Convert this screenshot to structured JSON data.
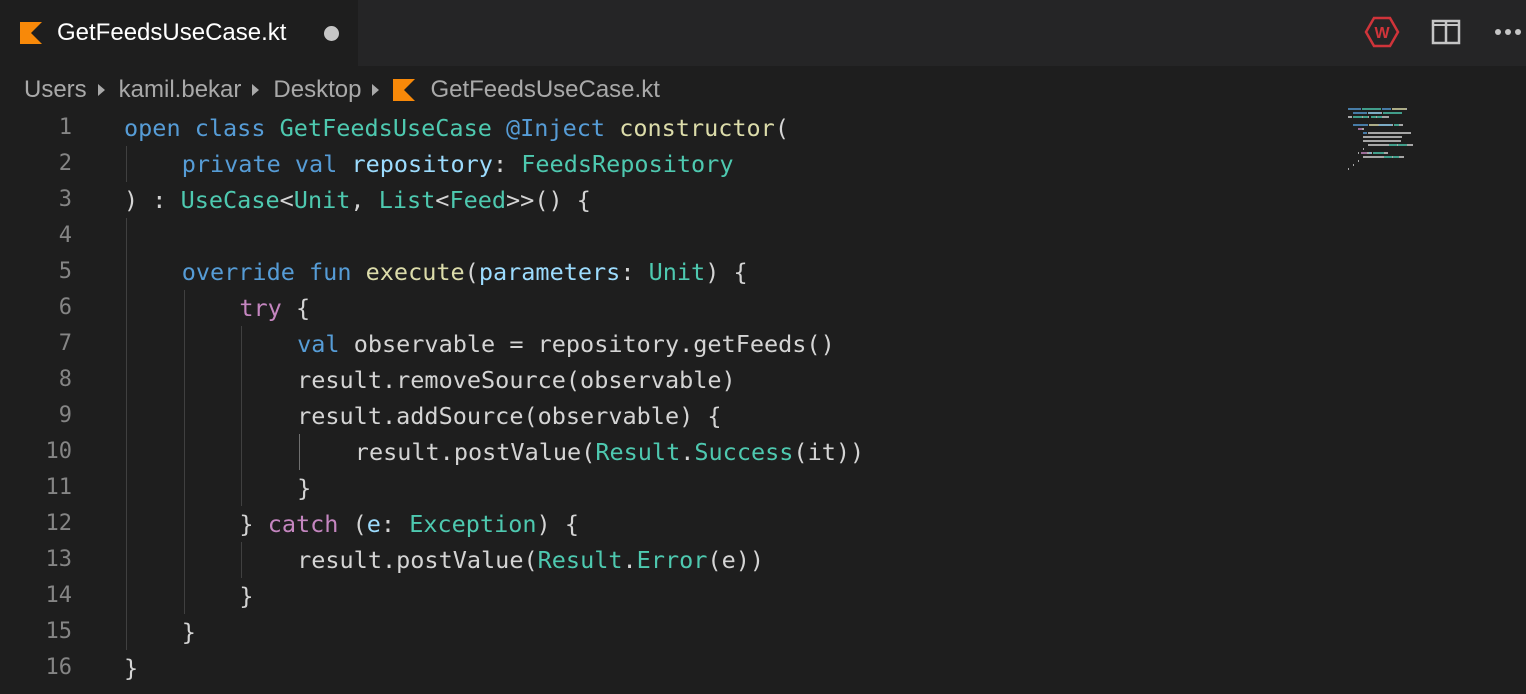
{
  "tab": {
    "title": "GetFeedsUseCase.kt",
    "dirty": true
  },
  "toolbar": {
    "badge_letter": "W"
  },
  "breadcrumbs": [
    "Users",
    "kamil.bekar",
    "Desktop",
    "GetFeedsUseCase.kt"
  ],
  "colors": {
    "keyword": "#569cd6",
    "control": "#c586c0",
    "type": "#4ec9b0",
    "function": "#dcdcaa",
    "variable": "#9cdcfe",
    "plain": "#d4d4d4",
    "kotlin_orange": "#f88909"
  },
  "code": [
    {
      "n": "1",
      "indent": 0,
      "tokens": [
        [
          "open class ",
          "keyword"
        ],
        [
          "GetFeedsUseCase ",
          "type"
        ],
        [
          "@Inject ",
          "keyword"
        ],
        [
          "constructor",
          "function"
        ],
        [
          "(",
          "plain"
        ]
      ]
    },
    {
      "n": "2",
      "indent": 1,
      "tokens": [
        [
          "private val ",
          "keyword"
        ],
        [
          "repository",
          "variable"
        ],
        [
          ": ",
          "plain"
        ],
        [
          "FeedsRepository",
          "type"
        ]
      ]
    },
    {
      "n": "3",
      "indent": 0,
      "tokens": [
        [
          ") : ",
          "plain"
        ],
        [
          "UseCase",
          "type"
        ],
        [
          "<",
          "plain"
        ],
        [
          "Unit",
          "type"
        ],
        [
          ", ",
          "plain"
        ],
        [
          "List",
          "type"
        ],
        [
          "<",
          "plain"
        ],
        [
          "Feed",
          "type"
        ],
        [
          ">>() {",
          "plain"
        ]
      ]
    },
    {
      "n": "4",
      "indent": 0,
      "tokens": []
    },
    {
      "n": "5",
      "indent": 1,
      "tokens": [
        [
          "override fun ",
          "keyword"
        ],
        [
          "execute",
          "function"
        ],
        [
          "(",
          "plain"
        ],
        [
          "parameters",
          "variable"
        ],
        [
          ": ",
          "plain"
        ],
        [
          "Unit",
          "type"
        ],
        [
          ") {",
          "plain"
        ]
      ]
    },
    {
      "n": "6",
      "indent": 2,
      "tokens": [
        [
          "try",
          "control"
        ],
        [
          " {",
          "plain"
        ]
      ]
    },
    {
      "n": "7",
      "indent": 3,
      "tokens": [
        [
          "val ",
          "keyword"
        ],
        [
          "observable = repository.getFeeds()",
          "plain"
        ]
      ]
    },
    {
      "n": "8",
      "indent": 3,
      "tokens": [
        [
          "result.removeSource(observable)",
          "plain"
        ]
      ]
    },
    {
      "n": "9",
      "indent": 3,
      "tokens": [
        [
          "result.addSource(observable) {",
          "plain"
        ]
      ]
    },
    {
      "n": "10",
      "indent": 4,
      "tokens": [
        [
          "result.postValue(",
          "plain"
        ],
        [
          "Result",
          "type"
        ],
        [
          ".",
          "plain"
        ],
        [
          "Success",
          "type"
        ],
        [
          "(it))",
          "plain"
        ]
      ]
    },
    {
      "n": "11",
      "indent": 3,
      "tokens": [
        [
          "}",
          "plain"
        ]
      ]
    },
    {
      "n": "12",
      "indent": 2,
      "tokens": [
        [
          "} ",
          "plain"
        ],
        [
          "catch",
          "control"
        ],
        [
          " (",
          "plain"
        ],
        [
          "e",
          "variable"
        ],
        [
          ": ",
          "plain"
        ],
        [
          "Exception",
          "type"
        ],
        [
          ") {",
          "plain"
        ]
      ]
    },
    {
      "n": "13",
      "indent": 3,
      "tokens": [
        [
          "result.postValue(",
          "plain"
        ],
        [
          "Result",
          "type"
        ],
        [
          ".",
          "plain"
        ],
        [
          "Error",
          "type"
        ],
        [
          "(e))",
          "plain"
        ]
      ]
    },
    {
      "n": "14",
      "indent": 2,
      "tokens": [
        [
          "}",
          "plain"
        ]
      ]
    },
    {
      "n": "15",
      "indent": 1,
      "tokens": [
        [
          "}",
          "plain"
        ]
      ]
    },
    {
      "n": "16",
      "indent": 0,
      "tokens": [
        [
          "}",
          "plain"
        ]
      ]
    }
  ]
}
